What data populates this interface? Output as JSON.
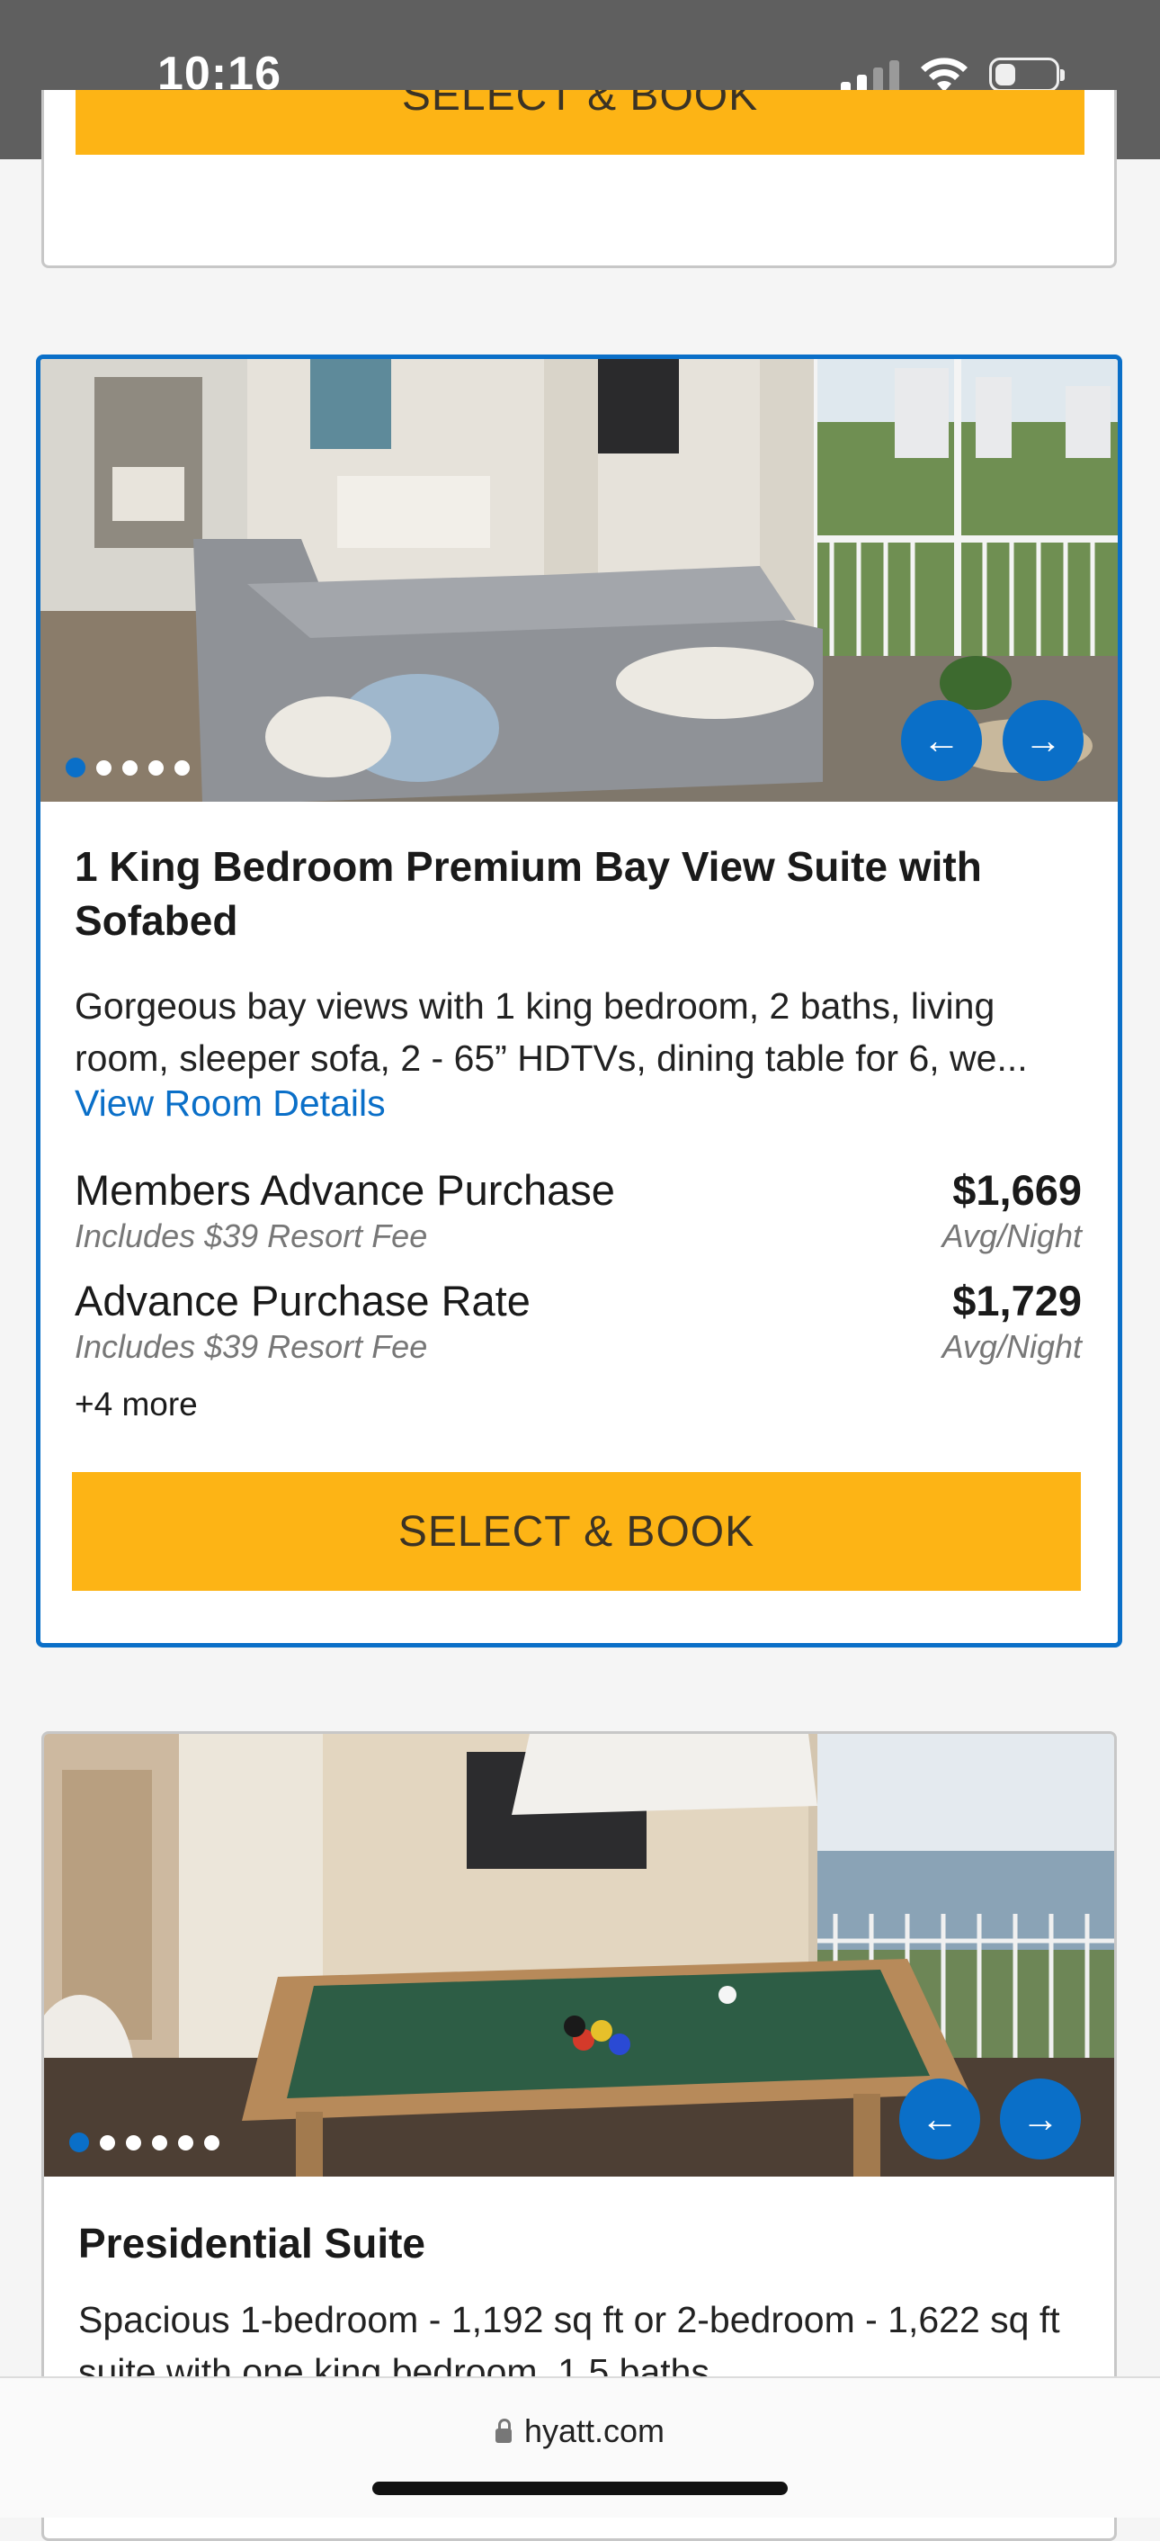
{
  "status_bar": {
    "time": "10:16"
  },
  "previous_card": {
    "button_label": "SELECT & BOOK"
  },
  "rooms": [
    {
      "title": "1 King Bedroom Premium Bay View Suite with Sofabed",
      "description": "Gorgeous bay views with 1 king bedroom, 2 baths, living room, sleeper sofa, 2 - 65” HDTVs, dining table for 6, we...",
      "details_link": "View Room Details",
      "image_dots": 5,
      "rates": [
        {
          "name": "Members Advance Purchase",
          "fee": "Includes $39 Resort Fee",
          "price": "$1,669",
          "unit": "Avg/Night"
        },
        {
          "name": "Advance Purchase Rate",
          "fee": "Includes $39 Resort Fee",
          "price": "$1,729",
          "unit": "Avg/Night"
        }
      ],
      "more": "+4 more",
      "button_label": "SELECT & BOOK"
    },
    {
      "title": "Presidential Suite",
      "description": "Spacious 1-bedroom - 1,192 sq ft or 2-bedroom - 1,622 sq ft suite with one king bedroom, 1.5 baths,",
      "image_dots": 6
    }
  ],
  "carousel": {
    "prev_icon": "←",
    "next_icon": "→"
  },
  "browser": {
    "url": "hyatt.com"
  },
  "colors": {
    "accent": "#0a6fc8",
    "book_button": "#fdb415"
  }
}
